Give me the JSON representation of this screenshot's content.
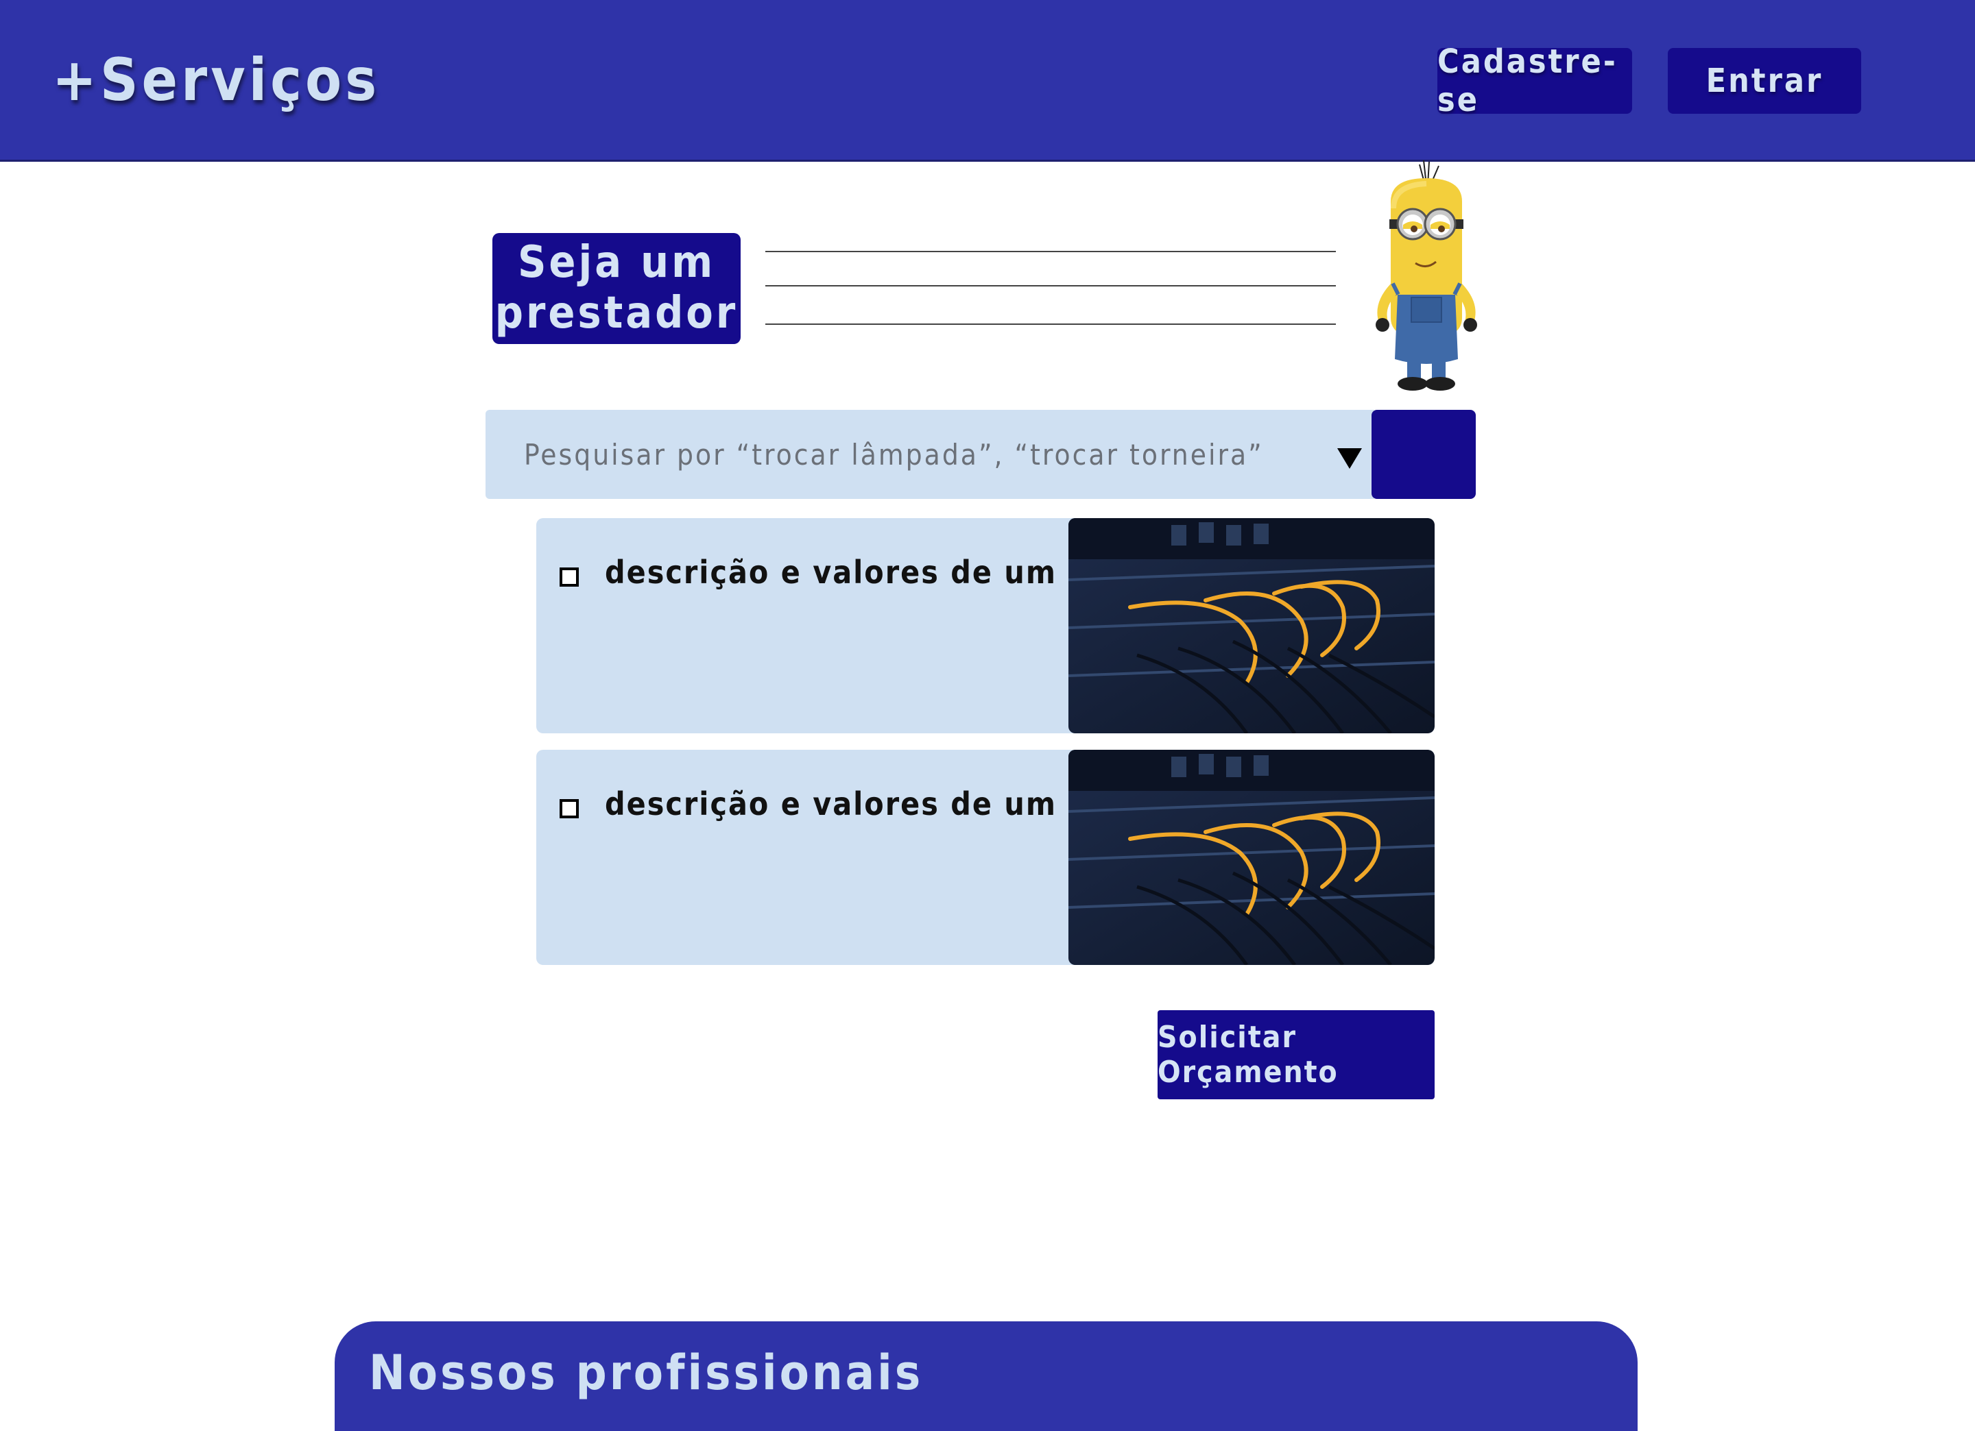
{
  "header": {
    "logo": "+Serviços",
    "signup_label": "Cadastre-se",
    "login_label": "Entrar"
  },
  "hero": {
    "title_line1": "Seja um",
    "title_line2": "prestador"
  },
  "search": {
    "placeholder": "Pesquisar por “trocar lâmpada”, “trocar torneira”"
  },
  "services": [
    {
      "label": "descrição e valores de um serviço"
    },
    {
      "label": "descrição e valores de um serviço"
    }
  ],
  "cta_label": "Solicitar Orçamento",
  "professionals": {
    "title": "Nossos profissionais"
  },
  "colors": {
    "header_bg": "#2f33a8",
    "button_bg": "#150b8c",
    "light_panel": "#cfe0f2",
    "light_text": "#cfe0f3"
  }
}
